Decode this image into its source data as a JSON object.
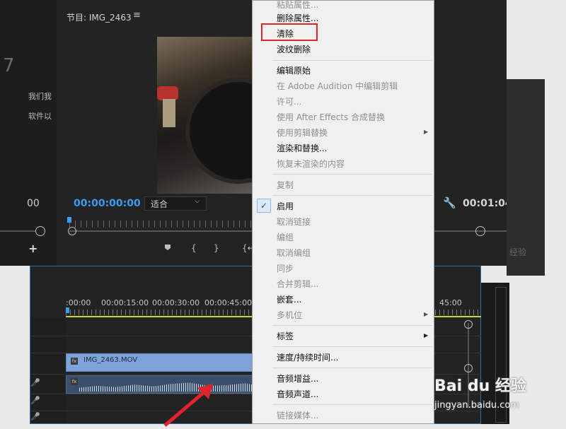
{
  "left_panel": {
    "partial_number": "7",
    "partial_text_1": "我们我",
    "partial_text_2": "软件以",
    "partial_timecode": "00"
  },
  "program_monitor": {
    "title": "节目: IMG_2463",
    "menu_glyph": "≡",
    "timecode": "00:00:00:00",
    "fit_value": "适合",
    "end_timecode": "00:01:04:"
  },
  "timeline": {
    "ruler_labels": [
      ":00:00",
      "00:00:15:00",
      "00:00:30:00",
      "00:00:45:00",
      "45:00"
    ],
    "video_clip_name": "IMG_2463.MOV",
    "fx_label": "fx"
  },
  "context_menu": {
    "items": [
      {
        "label": "粘贴属性...",
        "enabled": false
      },
      {
        "label": "删除属性...",
        "enabled": true
      },
      {
        "label": "清除",
        "enabled": true,
        "highlighted": true
      },
      {
        "label": "波纹删除",
        "enabled": true
      },
      {
        "label": "编辑原始",
        "enabled": true
      },
      {
        "label": "在 Adobe Audition 中编辑剪辑",
        "enabled": false
      },
      {
        "label": "许可...",
        "enabled": false
      },
      {
        "label": "使用 After Effects 合成替换",
        "enabled": false
      },
      {
        "label": "使用剪辑替换",
        "enabled": false,
        "submenu": true
      },
      {
        "label": "渲染和替换...",
        "enabled": true
      },
      {
        "label": "恢复未渲染的内容",
        "enabled": false
      },
      {
        "label": "复制",
        "enabled": false
      },
      {
        "label": "启用",
        "enabled": true,
        "checked": true
      },
      {
        "label": "取消链接",
        "enabled": false
      },
      {
        "label": "编组",
        "enabled": false
      },
      {
        "label": "取消编组",
        "enabled": false
      },
      {
        "label": "同步",
        "enabled": false
      },
      {
        "label": "合并剪辑...",
        "enabled": false
      },
      {
        "label": "嵌套...",
        "enabled": true
      },
      {
        "label": "多机位",
        "enabled": false,
        "submenu": true
      },
      {
        "label": "标签",
        "enabled": true,
        "submenu": true
      },
      {
        "label": "速度/持续时间...",
        "enabled": true
      },
      {
        "label": "音频增益...",
        "enabled": true
      },
      {
        "label": "音频声道...",
        "enabled": true
      },
      {
        "label": "链接媒体...",
        "enabled": false
      }
    ],
    "check_glyph": "✓",
    "submenu_glyph": "▶"
  },
  "watermark": {
    "brand": "Bai du 经验",
    "url": "jingyan.baidu.com"
  },
  "gray_block_text": "经验",
  "colors": {
    "accent_blue": "#3b9cf0",
    "highlight_red": "#e0242b",
    "menu_bg": "#f0f0f0",
    "panel_bg": "#232323"
  }
}
